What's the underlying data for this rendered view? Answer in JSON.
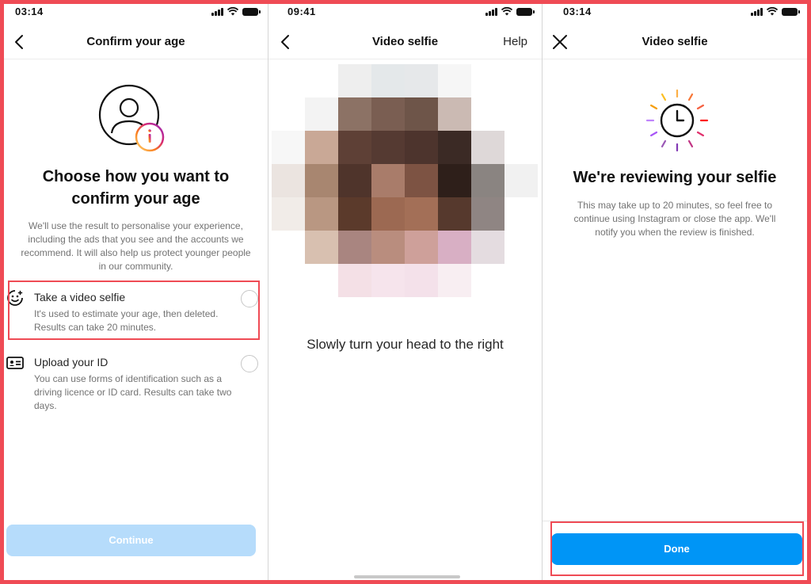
{
  "panel1": {
    "status_time": "03:14",
    "title": "Confirm your age",
    "heading_line1": "Choose how you want to",
    "heading_line2": "confirm your age",
    "description": "We'll use the result to personalise your experience, including the ads that you see and the accounts we recommend. It will also help us protect younger people in our community.",
    "option_video": {
      "title": "Take a video selfie",
      "desc": "It's used to estimate your age, then deleted. Results can take 20 minutes."
    },
    "option_id": {
      "title": "Upload your ID",
      "desc": "You can use forms of identification such as a driving licence or ID card. Results can take two days."
    },
    "continue_label": "Continue"
  },
  "panel2": {
    "status_time": "09:41",
    "title": "Video selfie",
    "help_label": "Help",
    "instruction": "Slowly turn your head to the right"
  },
  "panel3": {
    "status_time": "03:14",
    "title": "Video selfie",
    "heading": "We're reviewing your selfie",
    "description": "This may take up to 20 minutes, so feel free to continue using Instagram or close the app. We'll notify you when the review is finished.",
    "done_label": "Done"
  },
  "colors": {
    "accent_blue": "#0095f6",
    "disabled_blue": "#b6dcfb",
    "highlight_red": "#ef4b55"
  }
}
